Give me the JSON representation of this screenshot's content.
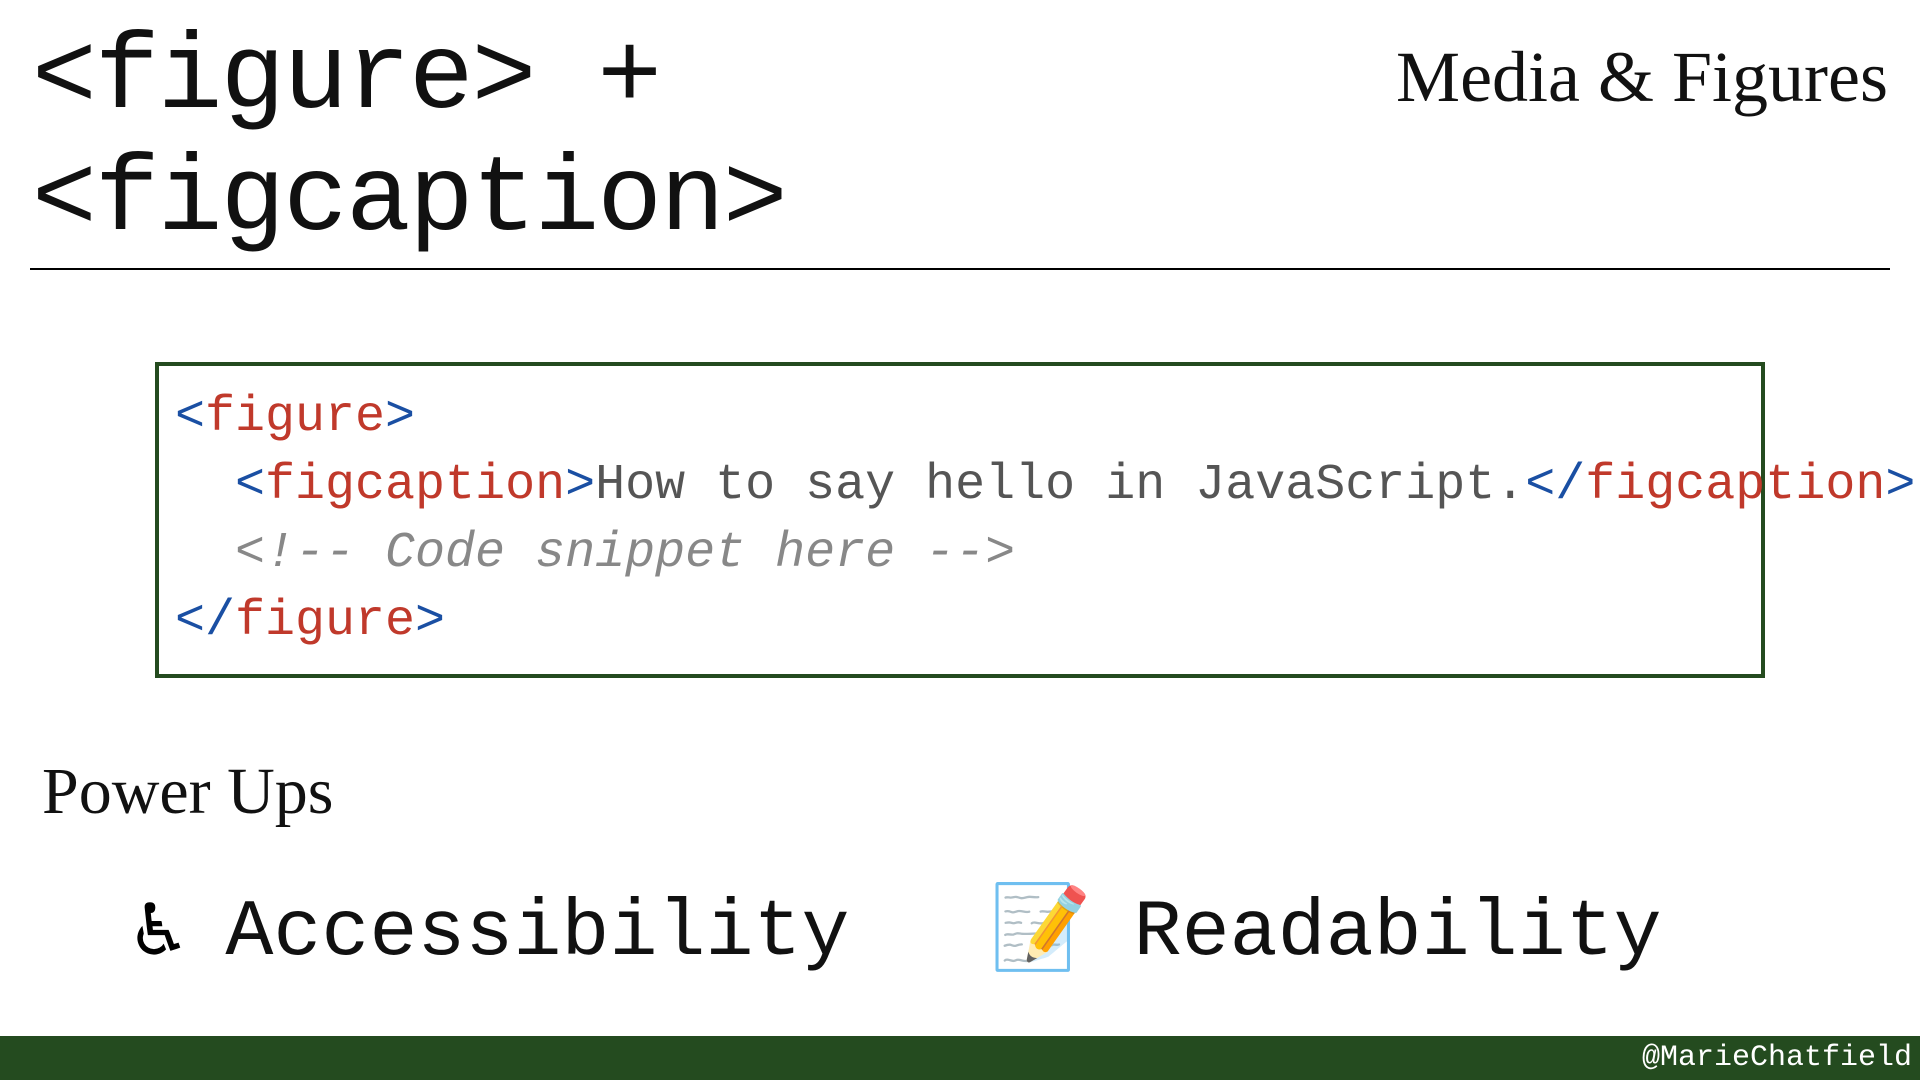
{
  "header": {
    "title": "<figure> + <figcaption>",
    "category": "Media & Figures"
  },
  "code": {
    "line1_open_bracket": "<",
    "line1_tag": "figure",
    "line1_close_bracket": ">",
    "line2_open_bracket": "<",
    "line2_open_tag": "figcaption",
    "line2_open_close_bracket": ">",
    "line2_text": "How to say hello in JavaScript.",
    "line2_close_open_bracket": "</",
    "line2_close_tag": "figcaption",
    "line2_close_close_bracket": ">",
    "line3_comment": "<!-- Code snippet here -->",
    "line4_open_bracket": "</",
    "line4_tag": "figure",
    "line4_close_bracket": ">"
  },
  "sections": {
    "powerups_title": "Power Ups"
  },
  "powerups": [
    {
      "icon": "♿",
      "label": "Accessibility"
    },
    {
      "icon": "📝",
      "label": "Readability"
    }
  ],
  "footer": {
    "handle": "@MarieChatfield"
  }
}
